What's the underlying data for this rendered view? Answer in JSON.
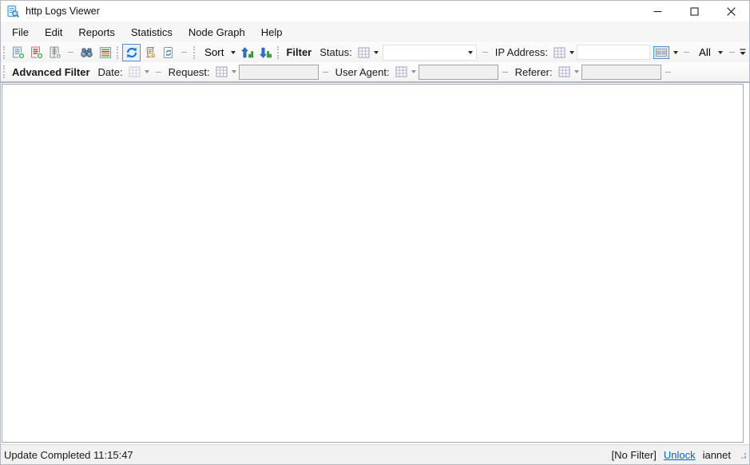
{
  "window": {
    "title": "http Logs Viewer"
  },
  "menu": {
    "items": [
      "File",
      "Edit",
      "Reports",
      "Statistics",
      "Node Graph",
      "Help"
    ]
  },
  "toolbar": {
    "sort_label": "Sort",
    "filter_label": "Filter",
    "status_label": "Status:",
    "status_value": "",
    "ip_label": "IP Address:",
    "ip_value": "",
    "scope_label": "All"
  },
  "advanced_filter": {
    "title": "Advanced Filter",
    "date_label": "Date:",
    "request_label": "Request:",
    "request_value": "",
    "user_agent_label": "User Agent:",
    "user_agent_value": "",
    "referer_label": "Referer:",
    "referer_value": ""
  },
  "status_bar": {
    "message": "Update Completed 11:15:47",
    "filter_state": "[No Filter]",
    "unlock_label": "Unlock",
    "user_label": "iannet"
  },
  "colors": {
    "accent_blue": "#2f86c8",
    "toggled_border": "#4f8fdd",
    "link_blue": "#0066cc",
    "success_green": "#3db54a",
    "error_red": "#cc3344",
    "warn_orange": "#ee8822"
  },
  "icons": {
    "app": "document-magnifier-icon",
    "window_controls": [
      "minimize-icon",
      "maximize-icon",
      "close-icon"
    ],
    "toolbar": [
      "add-access-log-icon",
      "add-error-log-icon",
      "add-zip-log-icon",
      "binoculars-search-icon",
      "highlight-rows-icon",
      "refresh-icon",
      "script-log-icon",
      "reload-file-icon",
      "sort-ascending-icon",
      "sort-descending-icon",
      "grid-picker-icon",
      "ip-display-toggle-icon",
      "toolbar-overflow-icon",
      "resize-grip-icon"
    ]
  }
}
